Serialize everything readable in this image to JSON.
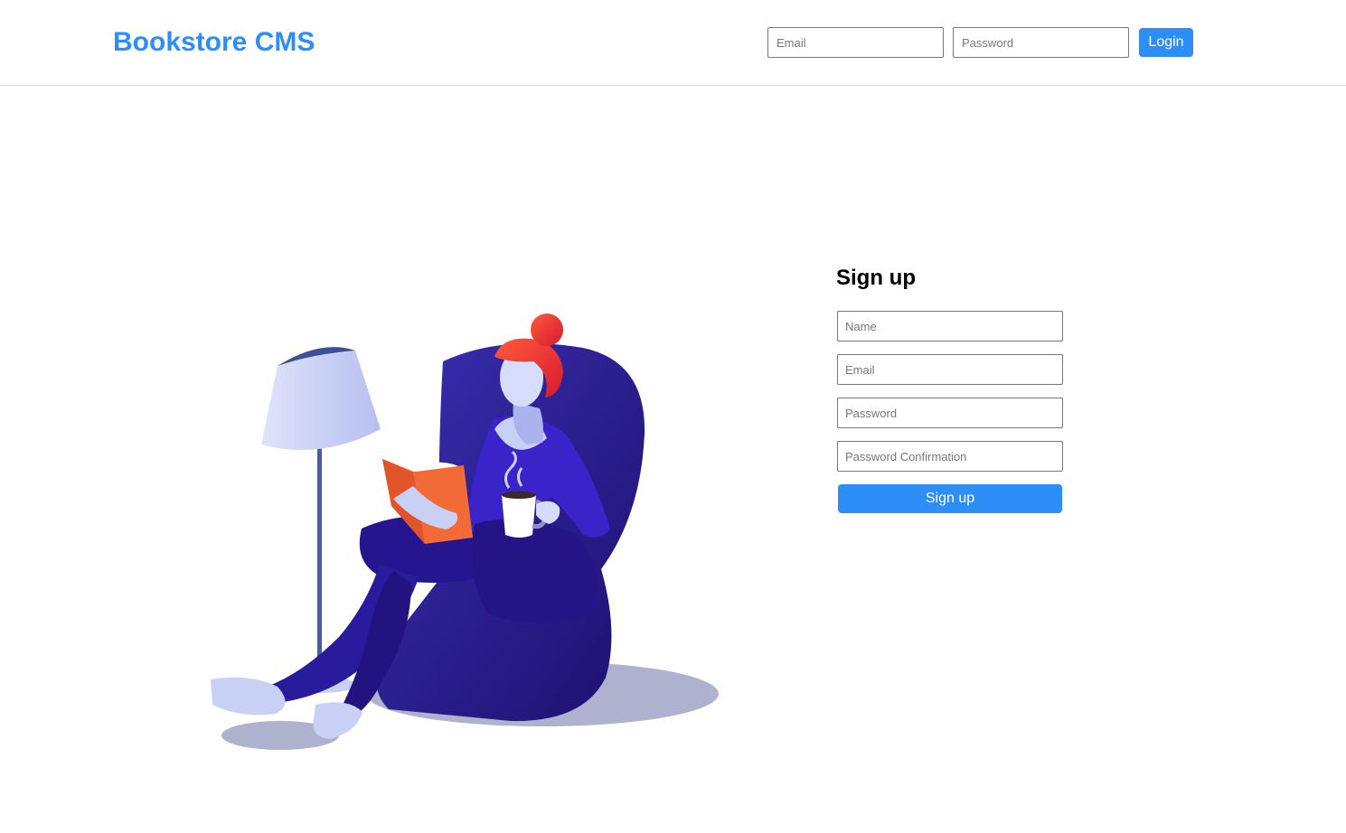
{
  "header": {
    "brand": "Bookstore CMS",
    "email_placeholder": "Email",
    "password_placeholder": "Password",
    "login_label": "Login"
  },
  "signup": {
    "title": "Sign up",
    "name_placeholder": "Name",
    "email_placeholder": "Email",
    "password_placeholder": "Password",
    "password_confirmation_placeholder": "Password Confirmation",
    "submit_label": "Sign up"
  },
  "illustration": {
    "subject": "woman-reading-in-armchair",
    "colors": {
      "chair": "#2a1a9c",
      "lamp_shade": "#c9d0f5",
      "hair": "#ef3b3b",
      "book": "#f26b36",
      "shadow": "#aeb2cf"
    }
  },
  "colors": {
    "brand": "#2e8ef7",
    "divider": "#dedede"
  }
}
